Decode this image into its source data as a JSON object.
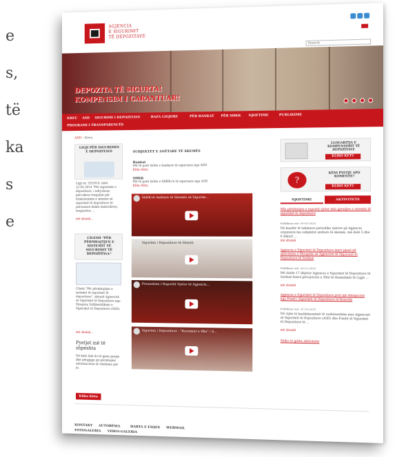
{
  "left_words": [
    "e",
    "s,",
    "të",
    "ka",
    "s",
    "e"
  ],
  "header": {
    "org_line1": "AGJENCIA",
    "org_line2": "E SIGURIMIT",
    "org_line3": "TË DEPOZITAVE",
    "search_placeholder": "Search"
  },
  "banner": {
    "line1": "DEPOZITA TË SIGURTA!",
    "line2": "KOMPENSIM I GARANTUAR!",
    "dots": [
      "1",
      "2",
      "3",
      "4"
    ]
  },
  "nav": [
    "KREU",
    "ASD",
    "SIGURIMI I DEPOZITAVE",
    "BAZA LIGJORE",
    "PËR BANKAT",
    "PËR SHKK",
    "NJOFTIME",
    "PUBLIKIME",
    "PROGRAMI I TRANSPARENCËS"
  ],
  "breadcrumb": {
    "home": "ASD",
    "current": "Kreu"
  },
  "left": {
    "law_title": "LIGJI PËR SIGURIMIN E DEPOZITAVE",
    "law_text": "Ligji nr. 53/2014, datë 22.05.2014 \"Për sigurimin e depozitave, i ndryshuar, përcakton rregullat për funksionimin e skemës së sigurimit të depozitave të personave fizikë (individëve), tregtarëve ...",
    "law_more": "më shumë...",
    "q_title": "CILESH \"PËR PËRMBAJTJEN E SISTEMIT TË SIGURIMIT TË DEPOZITAVE\"",
    "q_text": "Cilesh \"Për përmbajtjen e sistemit të sigurimit të depozitave\", aktuali Agjencisë së Sigurimit të Depozitave nga Sheqena Vallikeshilkimi e Sigurimit të Depozitave (ASD).",
    "q_more": "më shumë...",
    "ask_title": "Pyetjet më të shpeshta",
    "ask_text": "Në këtë link do të gjeni pyetje dhe përgjigje që përmbajnë informacione të vlefshme për ju.",
    "ask_btn": "Kliko Këtu"
  },
  "center": {
    "title": "SUBJEKTET E ANËTARE TË SKEMËS",
    "banks_head": "Bankat",
    "banks_text": "Për të parë listën e bankave të siguruara nga ASD",
    "banks_link": "Kliko Këtu",
    "shkk_head": "SHKK",
    "shkk_text": "Për të parë listën e SHKK-ve të siguruara nga ASD",
    "shkk_link": "Kliko Këtu",
    "videos": [
      {
        "title": "ShKK-të Anëtare të Skemës së Sigurim..."
      },
      {
        "title": "Sigurimi i Depozitave të Shtetit"
      },
      {
        "title": "Prezantimi i Raportit Vjetor të Agjencis..."
      },
      {
        "title": "Sigurimi i Depozitave - \"Kursimet e Mia\" / S..."
      }
    ]
  },
  "right": {
    "calc_title": "LLOGARITJA E KOMPENSIMIT TË DEPOZITAVE",
    "calc_btn": "KLIKO KËTU",
    "ask_title": "KËNI PYETJE APO KOMENTE?",
    "ask_btn": "KLIKO KËTU",
    "tab1": "NJOFTIME",
    "tab2": "AKTIVITETE",
    "news": [
      {
        "title": "Mbi përfshirjen e raportit vjetor mbi gjendjen e sistemit të sigurimit të depozitave",
        "date": "Publikuar më: 09-03-2020",
        "text": "Në kuadër të takimeve periodike vjetore që Agjencia organizon me subjektet anëtare të skemës, më datë 5 dhe 6 shkurt ...",
        "more": "më shumë"
      },
      {
        "title": "Agjencia e Sigurimit të Depozitave merr pjesë në aktivitetin e Shoqatës së Agjencive të Sigurimit të Depozitave të Serbisë",
        "date": "Publikuar më: 03-12-2019",
        "text": "Më datën 17 dhjetor Agjencia e Sigurimit të Depozitave të Serbisë festoi përvjetorin e 30të të themelimit të Ligjit ...",
        "more": "më shumë"
      },
      {
        "title": "Agjencia e Sigurimit të Depozitave pret një delegacion nga Fondi i Sigurimit të Depozitave të Kosovës",
        "date": "Publikuar më: 21-10-2019",
        "text": "Në vijim të bashkëpunimit të vazhdueshëm mes Agjencisë së Sigurimit të Depozitave (ASD) dhe Fondit të Sigurimit të Depozitave të ...",
        "more": "më shumë"
      }
    ],
    "all": "Shiko të gjitha aktivitetet"
  },
  "footer": {
    "l1": [
      "KONTAKT",
      "AUTORËSIA",
      "HARTA E FAQES",
      "WEBMAIL"
    ],
    "l2": [
      "FOTOGALERIA",
      "VIDEO-GALERIA"
    ]
  },
  "colors": {
    "brand": "#c8161d"
  }
}
